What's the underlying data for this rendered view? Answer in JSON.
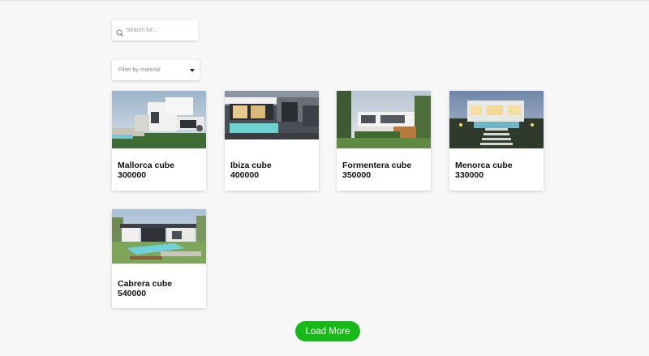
{
  "search": {
    "placeholder": "Search for..."
  },
  "filter": {
    "label": "Filter by material"
  },
  "products": [
    {
      "name": "Mallorca cube",
      "price": "300000"
    },
    {
      "name": "Ibiza cube",
      "price": "400000"
    },
    {
      "name": "Formentera cube",
      "price": "350000"
    },
    {
      "name": "Menorca cube",
      "price": "330000"
    },
    {
      "name": "Cabrera cube",
      "price": "540000"
    }
  ],
  "load_more": {
    "label": "Load More"
  },
  "colors": {
    "accent": "#17b917",
    "background": "#f7f7f7"
  }
}
